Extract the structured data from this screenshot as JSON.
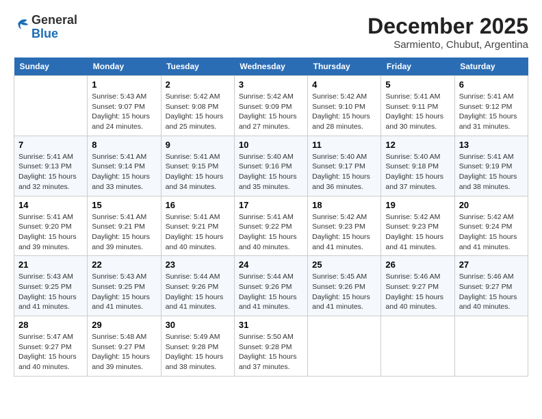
{
  "header": {
    "logo_line1": "General",
    "logo_line2": "Blue",
    "month": "December 2025",
    "location": "Sarmiento, Chubut, Argentina"
  },
  "days_of_week": [
    "Sunday",
    "Monday",
    "Tuesday",
    "Wednesday",
    "Thursday",
    "Friday",
    "Saturday"
  ],
  "weeks": [
    [
      {
        "day": "",
        "sunrise": "",
        "sunset": "",
        "daylight": ""
      },
      {
        "day": "1",
        "sunrise": "Sunrise: 5:43 AM",
        "sunset": "Sunset: 9:07 PM",
        "daylight": "Daylight: 15 hours and 24 minutes."
      },
      {
        "day": "2",
        "sunrise": "Sunrise: 5:42 AM",
        "sunset": "Sunset: 9:08 PM",
        "daylight": "Daylight: 15 hours and 25 minutes."
      },
      {
        "day": "3",
        "sunrise": "Sunrise: 5:42 AM",
        "sunset": "Sunset: 9:09 PM",
        "daylight": "Daylight: 15 hours and 27 minutes."
      },
      {
        "day": "4",
        "sunrise": "Sunrise: 5:42 AM",
        "sunset": "Sunset: 9:10 PM",
        "daylight": "Daylight: 15 hours and 28 minutes."
      },
      {
        "day": "5",
        "sunrise": "Sunrise: 5:41 AM",
        "sunset": "Sunset: 9:11 PM",
        "daylight": "Daylight: 15 hours and 30 minutes."
      },
      {
        "day": "6",
        "sunrise": "Sunrise: 5:41 AM",
        "sunset": "Sunset: 9:12 PM",
        "daylight": "Daylight: 15 hours and 31 minutes."
      }
    ],
    [
      {
        "day": "7",
        "sunrise": "Sunrise: 5:41 AM",
        "sunset": "Sunset: 9:13 PM",
        "daylight": "Daylight: 15 hours and 32 minutes."
      },
      {
        "day": "8",
        "sunrise": "Sunrise: 5:41 AM",
        "sunset": "Sunset: 9:14 PM",
        "daylight": "Daylight: 15 hours and 33 minutes."
      },
      {
        "day": "9",
        "sunrise": "Sunrise: 5:41 AM",
        "sunset": "Sunset: 9:15 PM",
        "daylight": "Daylight: 15 hours and 34 minutes."
      },
      {
        "day": "10",
        "sunrise": "Sunrise: 5:40 AM",
        "sunset": "Sunset: 9:16 PM",
        "daylight": "Daylight: 15 hours and 35 minutes."
      },
      {
        "day": "11",
        "sunrise": "Sunrise: 5:40 AM",
        "sunset": "Sunset: 9:17 PM",
        "daylight": "Daylight: 15 hours and 36 minutes."
      },
      {
        "day": "12",
        "sunrise": "Sunrise: 5:40 AM",
        "sunset": "Sunset: 9:18 PM",
        "daylight": "Daylight: 15 hours and 37 minutes."
      },
      {
        "day": "13",
        "sunrise": "Sunrise: 5:41 AM",
        "sunset": "Sunset: 9:19 PM",
        "daylight": "Daylight: 15 hours and 38 minutes."
      }
    ],
    [
      {
        "day": "14",
        "sunrise": "Sunrise: 5:41 AM",
        "sunset": "Sunset: 9:20 PM",
        "daylight": "Daylight: 15 hours and 39 minutes."
      },
      {
        "day": "15",
        "sunrise": "Sunrise: 5:41 AM",
        "sunset": "Sunset: 9:21 PM",
        "daylight": "Daylight: 15 hours and 39 minutes."
      },
      {
        "day": "16",
        "sunrise": "Sunrise: 5:41 AM",
        "sunset": "Sunset: 9:21 PM",
        "daylight": "Daylight: 15 hours and 40 minutes."
      },
      {
        "day": "17",
        "sunrise": "Sunrise: 5:41 AM",
        "sunset": "Sunset: 9:22 PM",
        "daylight": "Daylight: 15 hours and 40 minutes."
      },
      {
        "day": "18",
        "sunrise": "Sunrise: 5:42 AM",
        "sunset": "Sunset: 9:23 PM",
        "daylight": "Daylight: 15 hours and 41 minutes."
      },
      {
        "day": "19",
        "sunrise": "Sunrise: 5:42 AM",
        "sunset": "Sunset: 9:23 PM",
        "daylight": "Daylight: 15 hours and 41 minutes."
      },
      {
        "day": "20",
        "sunrise": "Sunrise: 5:42 AM",
        "sunset": "Sunset: 9:24 PM",
        "daylight": "Daylight: 15 hours and 41 minutes."
      }
    ],
    [
      {
        "day": "21",
        "sunrise": "Sunrise: 5:43 AM",
        "sunset": "Sunset: 9:25 PM",
        "daylight": "Daylight: 15 hours and 41 minutes."
      },
      {
        "day": "22",
        "sunrise": "Sunrise: 5:43 AM",
        "sunset": "Sunset: 9:25 PM",
        "daylight": "Daylight: 15 hours and 41 minutes."
      },
      {
        "day": "23",
        "sunrise": "Sunrise: 5:44 AM",
        "sunset": "Sunset: 9:26 PM",
        "daylight": "Daylight: 15 hours and 41 minutes."
      },
      {
        "day": "24",
        "sunrise": "Sunrise: 5:44 AM",
        "sunset": "Sunset: 9:26 PM",
        "daylight": "Daylight: 15 hours and 41 minutes."
      },
      {
        "day": "25",
        "sunrise": "Sunrise: 5:45 AM",
        "sunset": "Sunset: 9:26 PM",
        "daylight": "Daylight: 15 hours and 41 minutes."
      },
      {
        "day": "26",
        "sunrise": "Sunrise: 5:46 AM",
        "sunset": "Sunset: 9:27 PM",
        "daylight": "Daylight: 15 hours and 40 minutes."
      },
      {
        "day": "27",
        "sunrise": "Sunrise: 5:46 AM",
        "sunset": "Sunset: 9:27 PM",
        "daylight": "Daylight: 15 hours and 40 minutes."
      }
    ],
    [
      {
        "day": "28",
        "sunrise": "Sunrise: 5:47 AM",
        "sunset": "Sunset: 9:27 PM",
        "daylight": "Daylight: 15 hours and 40 minutes."
      },
      {
        "day": "29",
        "sunrise": "Sunrise: 5:48 AM",
        "sunset": "Sunset: 9:27 PM",
        "daylight": "Daylight: 15 hours and 39 minutes."
      },
      {
        "day": "30",
        "sunrise": "Sunrise: 5:49 AM",
        "sunset": "Sunset: 9:28 PM",
        "daylight": "Daylight: 15 hours and 38 minutes."
      },
      {
        "day": "31",
        "sunrise": "Sunrise: 5:50 AM",
        "sunset": "Sunset: 9:28 PM",
        "daylight": "Daylight: 15 hours and 37 minutes."
      },
      {
        "day": "",
        "sunrise": "",
        "sunset": "",
        "daylight": ""
      },
      {
        "day": "",
        "sunrise": "",
        "sunset": "",
        "daylight": ""
      },
      {
        "day": "",
        "sunrise": "",
        "sunset": "",
        "daylight": ""
      }
    ]
  ]
}
